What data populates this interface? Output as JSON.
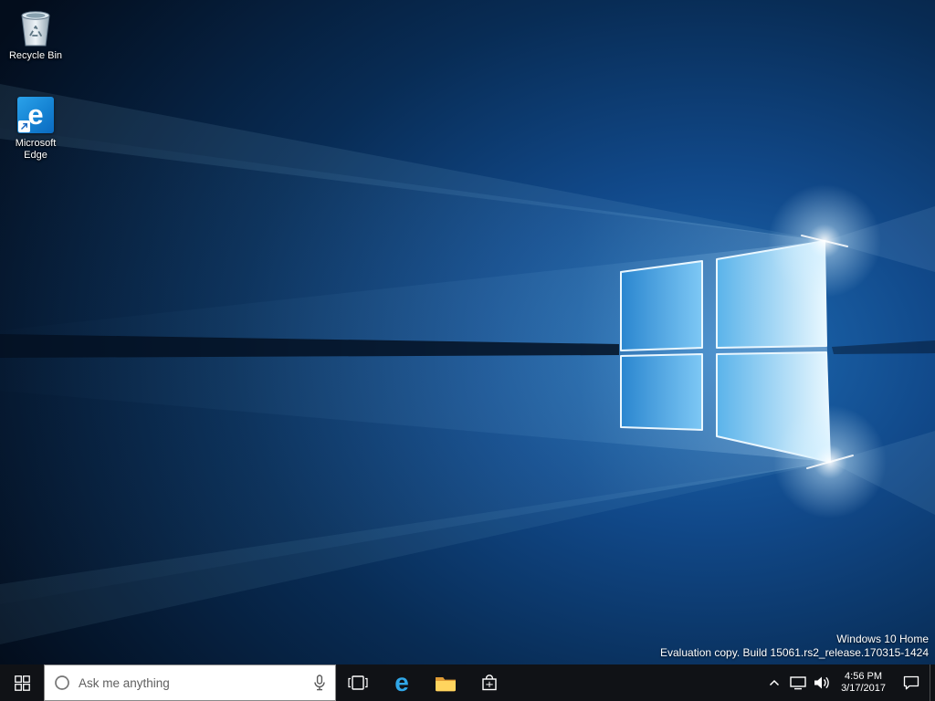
{
  "desktop": {
    "icons": [
      {
        "id": "recycle-bin",
        "label": "Recycle Bin",
        "icon": "recycle-bin-icon"
      },
      {
        "id": "microsoft-edge",
        "label": "Microsoft Edge",
        "icon": "edge-icon",
        "letter": "e"
      }
    ],
    "watermark": {
      "line1": "Windows 10 Home",
      "line2": "Evaluation copy. Build 15061.rs2_release.170315-1424"
    }
  },
  "taskbar": {
    "start": {
      "icon": "windows-logo-icon"
    },
    "search": {
      "placeholder": "Ask me anything",
      "left_icon": "cortana-circle-icon",
      "right_icon": "microphone-icon"
    },
    "app_buttons": [
      {
        "id": "task-view",
        "icon": "task-view-icon"
      },
      {
        "id": "edge",
        "icon": "edge-e-icon",
        "letter": "e"
      },
      {
        "id": "file-explorer",
        "icon": "folder-icon"
      },
      {
        "id": "store",
        "icon": "shopping-bag-icon"
      }
    ],
    "tray": {
      "chevron_icon": "chevron-up-icon",
      "network_icon": "network-icon",
      "volume_icon": "speaker-icon",
      "time": "4:56 PM",
      "date": "3/17/2017",
      "action_center_icon": "action-center-icon"
    }
  },
  "colors": {
    "taskbar_bg": "#101216",
    "search_bg": "#ffffff",
    "search_text": "#5f5f5f",
    "edge_blue": "#30a7e8",
    "folder_yellow": "#ffd45e",
    "wallpaper_deep": "#030d1c",
    "wallpaper_glow": "#1e6cb5",
    "pane_highlight": "#eaf7ff"
  }
}
